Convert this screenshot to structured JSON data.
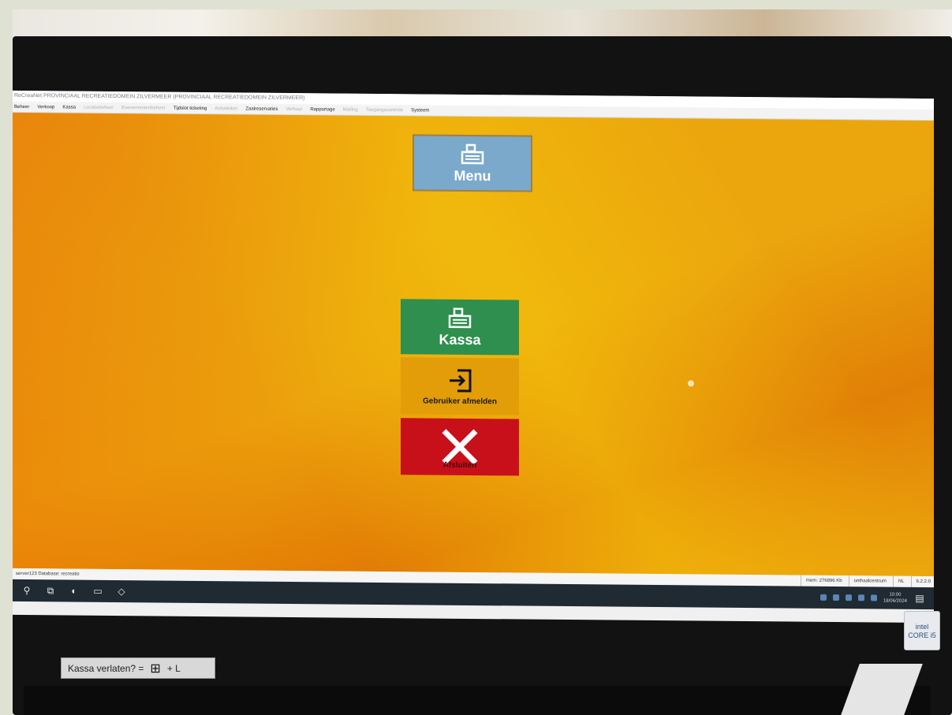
{
  "window": {
    "title": "ReCreaNet PROVINCIAAL RECREATIEDOMEIN ZILVERMEER (PROVINCIAAL RECREATIEDOMEIN ZILVERMEER)"
  },
  "menubar": [
    {
      "label": "Beheer",
      "dim": false
    },
    {
      "label": "Verkoop",
      "dim": false
    },
    {
      "label": "Kassa",
      "dim": false
    },
    {
      "label": "Locatiebeheer",
      "dim": true
    },
    {
      "label": "Evenementenbeheer",
      "dim": true
    },
    {
      "label": "Tijdslot ticketing",
      "dim": false
    },
    {
      "label": "Activiteiten",
      "dim": true
    },
    {
      "label": "Zaalreservaties",
      "dim": false
    },
    {
      "label": "Verhuur",
      "dim": true
    },
    {
      "label": "Rapportage",
      "dim": false
    },
    {
      "label": "Mailing",
      "dim": true
    },
    {
      "label": "Toegangscontrole",
      "dim": true
    },
    {
      "label": "Systeem",
      "dim": false
    }
  ],
  "tiles": {
    "menu": {
      "label": "Menu",
      "icon": "cash-register-icon"
    },
    "kassa": {
      "label": "Kassa",
      "icon": "cash-register-icon"
    },
    "afmelden": {
      "label": "Gebruiker afmelden",
      "icon": "logout-icon"
    },
    "afsluiten": {
      "label": "Afsluiten",
      "icon": "close-icon"
    }
  },
  "statusbar": {
    "left": "server123 Database: recreatie",
    "mem": "mem: 276896 Kb",
    "location": "onthaalcentrum",
    "lang": "NL",
    "version": "6.2.2.0"
  },
  "taskbar": {
    "time": "10:00",
    "date": "18/06/2024"
  },
  "sticker": {
    "text": "Kassa verlaten? =",
    "suffix": "+ L"
  },
  "hardware": {
    "badge": "intel CORE i5"
  },
  "colors": {
    "kassa": "#2f8f4e",
    "afsluiten": "#c8101a",
    "menu": "#7aa9cb",
    "desktop": "#eba60d"
  }
}
